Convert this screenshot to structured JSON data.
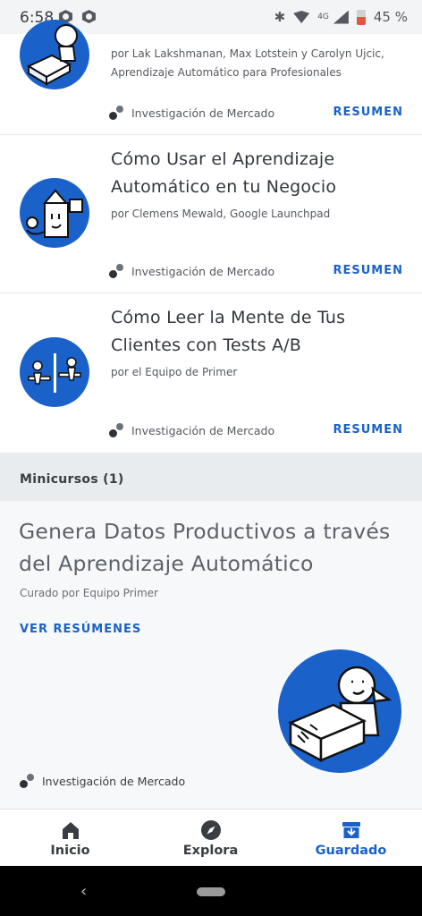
{
  "status_bar": {
    "time": "6:58",
    "network": "4G",
    "battery": "45 %"
  },
  "cards": [
    {
      "title": "",
      "byline": "por Lak Lakshmanan, Max Lotstein y Carolyn Ujcic, Aprendizaje Automático para Profesionales",
      "category": "Investigación de Mercado",
      "action": "RESUMEN",
      "icon": "person-with-box-illustration"
    },
    {
      "title": "Cómo Usar el Aprendizaje Automático en tu Negocio",
      "byline": "por Clemens Mewald, Google Launchpad",
      "category": "Investigación de Mercado",
      "action": "RESUMEN",
      "icon": "robot-illustration"
    },
    {
      "title": "Cómo Leer la Mente de Tus Clientes con Tests A/B",
      "byline": "por el Equipo de Primer",
      "category": "Investigación de Mercado",
      "action": "RESUMEN",
      "icon": "ab-test-desks-illustration"
    }
  ],
  "section_header": "Minicursos (1)",
  "minicourse": {
    "title": "Genera Datos Productivos a través del Aprendizaje Automático",
    "byline": "Curado por Equipo Primer",
    "action": "VER RESÚMENES",
    "category": "Investigación de Mercado",
    "icon": "person-with-box-illustration"
  },
  "bottom_nav": [
    {
      "label": "Inicio",
      "icon": "home-icon",
      "active": false
    },
    {
      "label": "Explora",
      "icon": "compass-icon",
      "active": false
    },
    {
      "label": "Guardado",
      "icon": "saved-archive-icon",
      "active": true
    }
  ],
  "colors": {
    "accent": "#1a62c9",
    "text": "#33373d",
    "section_bg": "#e9ecef"
  }
}
